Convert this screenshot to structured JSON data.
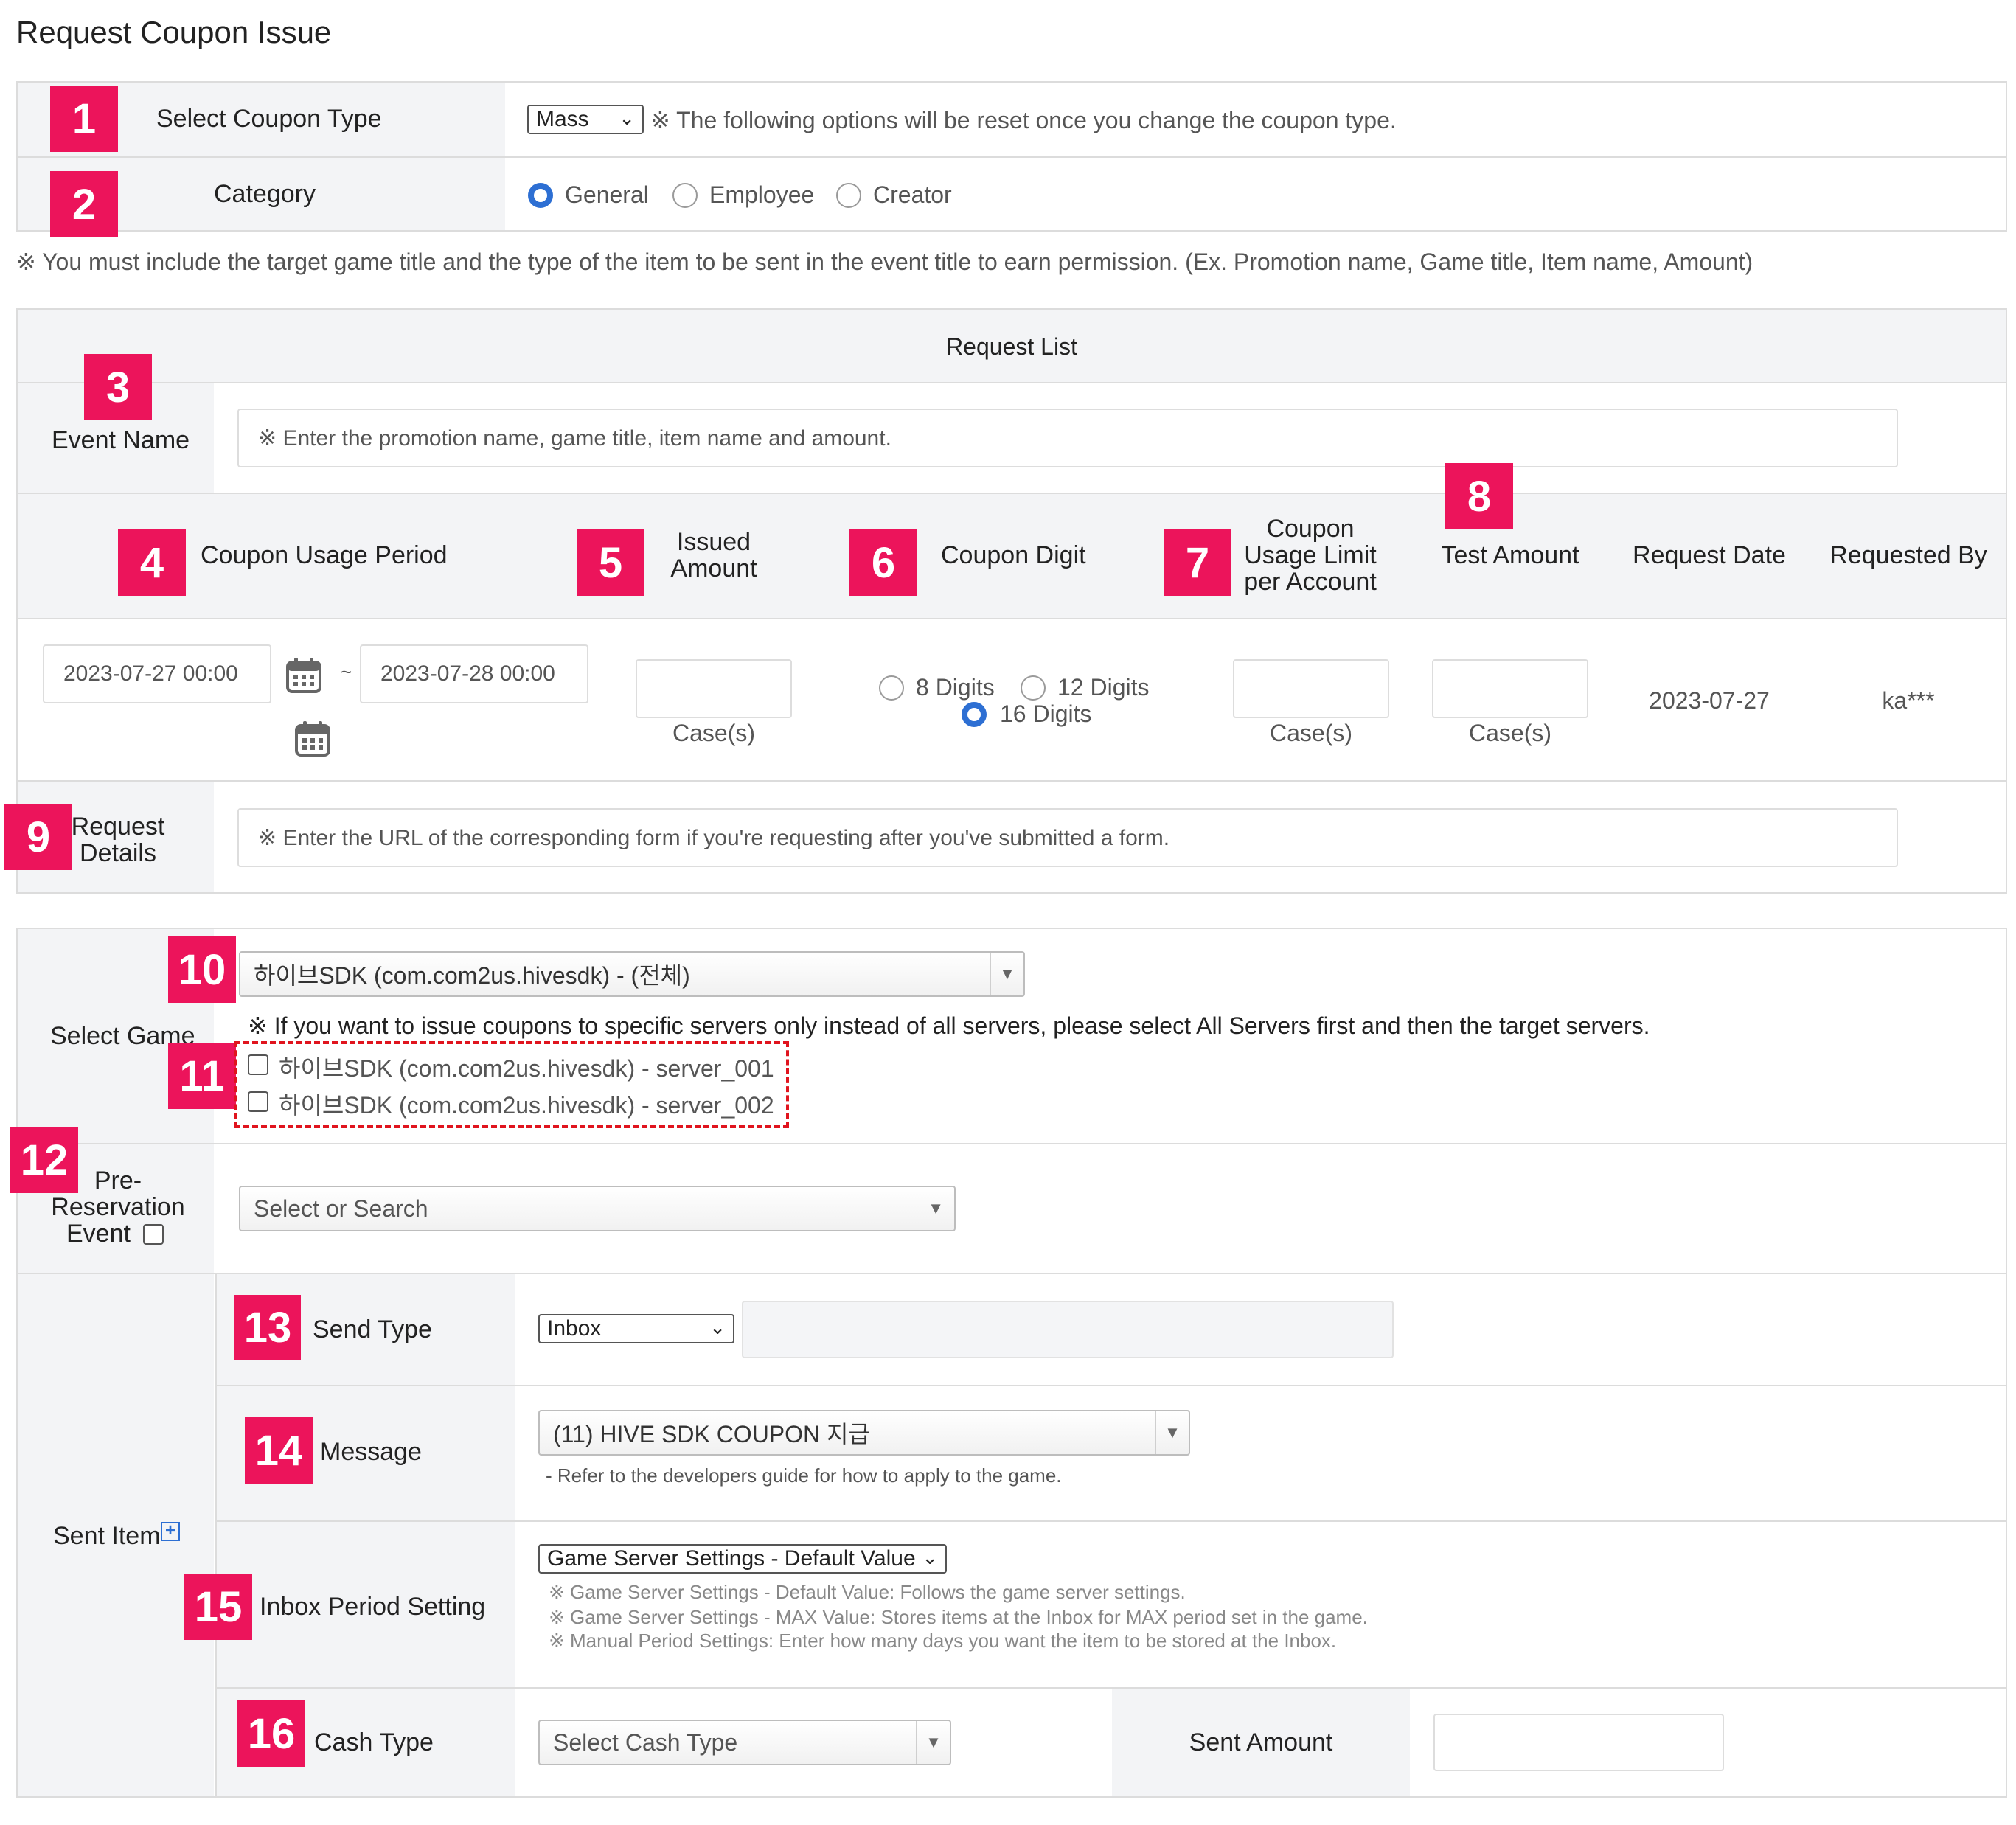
{
  "page_title": "Request Coupon Issue",
  "badges": [
    "1",
    "2",
    "3",
    "4",
    "5",
    "6",
    "7",
    "8",
    "9",
    "10",
    "11",
    "12",
    "13",
    "14",
    "15",
    "16"
  ],
  "coupon_type": {
    "label": "Select Coupon Type",
    "value": "Mass",
    "note": "※ The following options will be reset once you change the coupon type."
  },
  "category": {
    "label": "Category",
    "options": [
      "General",
      "Employee",
      "Creator"
    ],
    "selected": "General"
  },
  "notice": "※ You must include the target game title and the type of the item to be sent in the event title to earn permission. (Ex. Promotion name, Game title, Item name, Amount)",
  "request_list": {
    "title": "Request List",
    "event_name_label": "Event Name",
    "event_name_placeholder": "※ Enter the promotion name, game title, item name and amount.",
    "headers": {
      "usage_period": "Coupon Usage Period",
      "issued_amount_1": "Issued",
      "issued_amount_2": "Amount",
      "coupon_digit": "Coupon Digit",
      "usage_limit_1": "Coupon",
      "usage_limit_2": "Usage Limit",
      "usage_limit_3": "per Account",
      "test_amount": "Test Amount",
      "request_date": "Request Date",
      "requested_by": "Requested By"
    },
    "start_date": "2023-07-27 00:00",
    "date_separator": "~",
    "end_date": "2023-07-28 00:00",
    "case_unit": "Case(s)",
    "digit_options": [
      "8 Digits",
      "12 Digits",
      "16 Digits"
    ],
    "digit_selected": "16 Digits",
    "request_date_value": "2023-07-27",
    "requested_by_value": "ka***",
    "request_details_label_1": "Request",
    "request_details_label_2": "Details",
    "request_details_placeholder": "※ Enter the URL of the corresponding form if you're requesting after you've submitted a form."
  },
  "select_game": {
    "label": "Select Game",
    "value": "하이브SDK (com.com2us.hivesdk) - (전체)",
    "note": "※ If you want to issue coupons to specific servers only instead of all servers, please select All Servers first and then the target servers.",
    "servers": [
      "하이브SDK (com.com2us.hivesdk) - server_001",
      "하이브SDK (com.com2us.hivesdk) - server_002"
    ]
  },
  "pre_reservation": {
    "label_1": "Pre-",
    "label_2": "Reservation",
    "label_3": "Event",
    "placeholder": "Select or Search"
  },
  "sent_item": {
    "label": "Sent Item",
    "send_type_label": "Send Type",
    "send_type_value": "Inbox",
    "message_label": "Message",
    "message_value": "(11) HIVE SDK COUPON 지급",
    "message_note": "- Refer to the developers guide for how to apply to the game.",
    "inbox_period_label": "Inbox Period Setting",
    "inbox_period_value": "Game Server Settings - Default Value",
    "inbox_notes": [
      "※ Game Server Settings - Default Value: Follows the game server settings.",
      "※ Game Server Settings - MAX Value: Stores items at the Inbox for MAX period set in the game.",
      "※ Manual Period Settings: Enter how many days you want the item to be stored at the Inbox."
    ],
    "cash_type_label": "Cash Type",
    "cash_type_placeholder": "Select Cash Type",
    "sent_amount_label": "Sent Amount"
  },
  "icons": {
    "calendar": "calendar-icon",
    "dropdown": "chevron-down-icon",
    "add": "plus-square-icon"
  },
  "colors": {
    "badge": "#ec145b",
    "radio_selected": "#2d6fd3",
    "dashed_border": "#e0141e",
    "add_icon": "#2d6fd3"
  }
}
